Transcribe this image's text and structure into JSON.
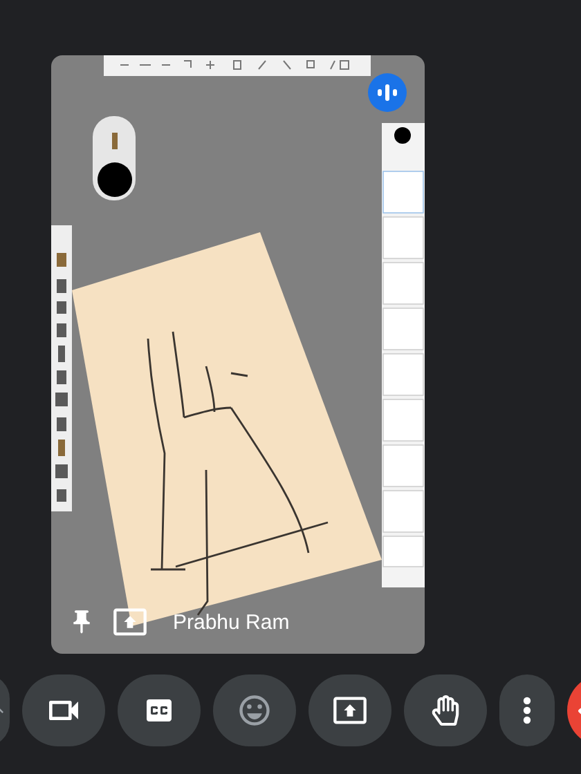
{
  "tile": {
    "name": "Prabhu Ram",
    "speaking": true,
    "pinned": true
  },
  "controls": [
    {
      "kind": "more-left"
    },
    {
      "kind": "camera"
    },
    {
      "kind": "captions"
    },
    {
      "kind": "emoji"
    },
    {
      "kind": "present"
    },
    {
      "kind": "hand"
    },
    {
      "kind": "more"
    },
    {
      "kind": "end-call"
    }
  ]
}
